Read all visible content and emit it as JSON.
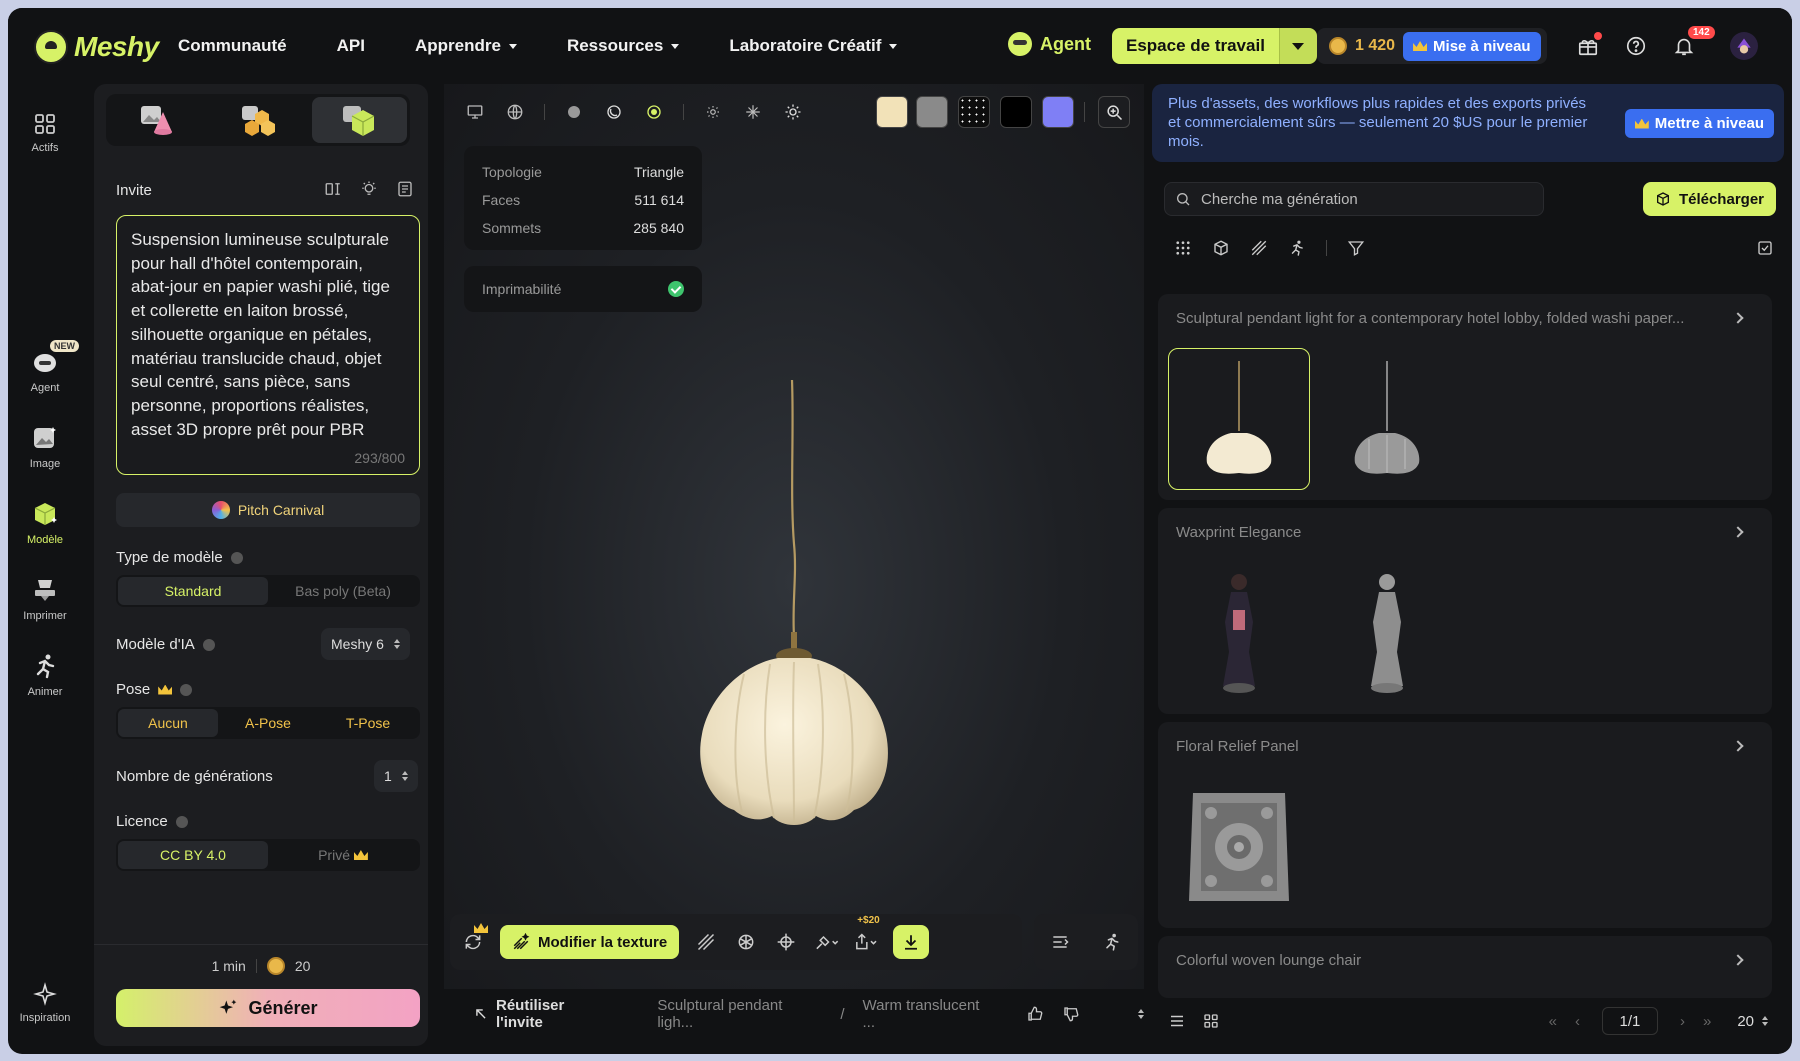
{
  "brand": {
    "name": "Meshy"
  },
  "nav": [
    {
      "label": "Communauté",
      "dropdown": false
    },
    {
      "label": "API",
      "dropdown": false
    },
    {
      "label": "Apprendre",
      "dropdown": true
    },
    {
      "label": "Ressources",
      "dropdown": true
    },
    {
      "label": "Laboratoire Créatif",
      "dropdown": true
    }
  ],
  "top": {
    "agent_label": "Agent",
    "workspace_label": "Espace de travail",
    "credits": "1 420",
    "upgrade_label": "Mise à niveau",
    "notifications": "142",
    "icons": [
      "gift-icon",
      "help-icon",
      "bell-icon",
      "avatar"
    ]
  },
  "rail": [
    {
      "label": "Actifs",
      "icon": "grid-icon"
    },
    {
      "label": "Agent",
      "icon": "agent-icon",
      "badge": "NEW"
    },
    {
      "label": "Image",
      "icon": "image-icon"
    },
    {
      "label": "Modèle",
      "icon": "cube-icon",
      "active": true
    },
    {
      "label": "Imprimer",
      "icon": "printer-icon"
    },
    {
      "label": "Animer",
      "icon": "run-icon"
    },
    {
      "label": "Inspiration",
      "icon": "sparkle-icon"
    }
  ],
  "panel": {
    "prompt_label": "Invite",
    "prompt_text": "Suspension lumineuse sculpturale pour hall d'hôtel contemporain, abat-jour en papier washi plié, tige et collerette en laiton brossé, silhouette organique en pétales, matériau translucide chaud, objet seul centré, sans pièce, sans personne, proportions réalistes, asset 3D propre prêt pour PBR",
    "prompt_count": "293/800",
    "style_label": "Pitch Carnival",
    "model_type_label": "Type de modèle",
    "model_types": [
      "Standard",
      "Bas poly (Beta)"
    ],
    "ai_model_label": "Modèle d'IA",
    "ai_model_value": "Meshy 6",
    "pose_label": "Pose",
    "poses": [
      "Aucun",
      "A-Pose",
      "T-Pose"
    ],
    "gen_count_label": "Nombre de générations",
    "gen_count_value": "1",
    "license_label": "Licence",
    "licenses": [
      "CC BY 4.0",
      "Privé"
    ],
    "time": "1 min",
    "cost": "20",
    "generate_label": "Générer"
  },
  "viewport": {
    "stats": [
      {
        "label": "Topologie",
        "value": "Triangle"
      },
      {
        "label": "Faces",
        "value": "511 614"
      },
      {
        "label": "Sommets",
        "value": "285 840"
      }
    ],
    "printable_label": "Imprimabilité",
    "swatches": [
      "#f2e2b8",
      "#8a8a8a",
      "#0d0d0d",
      "#000000",
      "#7f7ff5"
    ],
    "texture_label": "Modifier la texture",
    "export_badge": "+$20",
    "reuse_label": "Réutiliser l'invite",
    "crumb1": "Sculptural pendant ligh...",
    "crumb2": "Warm translucent ..."
  },
  "right": {
    "promo_text": "Plus d'assets, des workflows plus rapides et des exports privés et commercialement sûrs — seulement 20 $US pour le premier mois.",
    "promo_btn": "Mettre à niveau",
    "search_placeholder": "Cherche ma génération",
    "upload_label": "Télécharger",
    "cards": [
      {
        "title": "Sculptural pendant light for a contemporary hotel lobby, folded washi paper..."
      },
      {
        "title": "Waxprint Elegance"
      },
      {
        "title": "Floral Relief Panel"
      },
      {
        "title": "Colorful woven lounge chair"
      }
    ],
    "page": "1/1",
    "per_page": "20"
  }
}
